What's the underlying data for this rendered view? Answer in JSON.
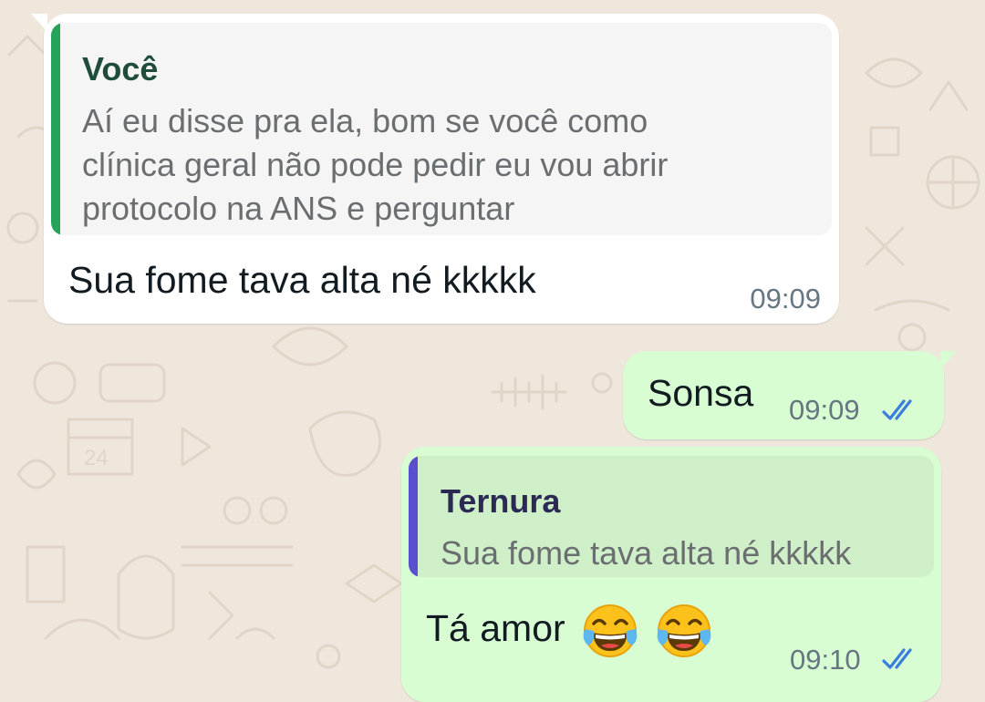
{
  "colors": {
    "incoming_bubble": "#ffffff",
    "outgoing_bubble": "#d9fdd3",
    "quote_bar_you": "#25a35a",
    "quote_author_you": "#1f4d3a",
    "quote_bar_contact": "#5a4fcf",
    "quote_author_contact": "#2a2a55",
    "read_ticks": "#3b7ddd",
    "wallpaper": "#efe7dc"
  },
  "messages": [
    {
      "direction": "incoming",
      "quoted_author": "Você",
      "quoted_lines": [
        "Aí eu disse pra ela, bom se você como",
        "clínica geral não pode pedir eu vou abrir",
        "protocolo na ANS e perguntar"
      ],
      "text": "Sua fome tava alta né kkkkk",
      "time": "09:09"
    },
    {
      "direction": "outgoing",
      "text": "Sonsa",
      "time": "09:09",
      "status_icon": "double-check-read-icon"
    },
    {
      "direction": "outgoing",
      "quoted_author": "Ternura",
      "quoted_lines": [
        "Sua fome tava alta né kkkkk"
      ],
      "text": "Tá amor",
      "emojis": [
        "tears-of-joy-emoji",
        "tears-of-joy-emoji"
      ],
      "time": "09:10",
      "status_icon": "double-check-read-icon"
    }
  ]
}
